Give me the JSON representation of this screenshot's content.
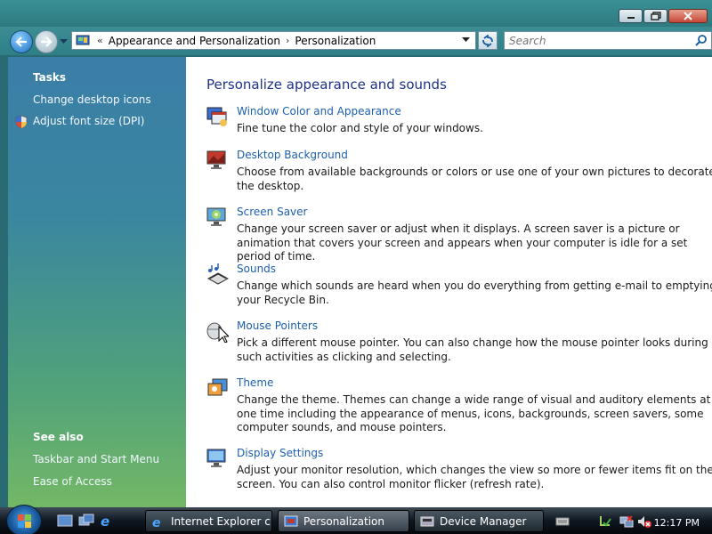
{
  "address": {
    "crumbs": [
      "Appearance and Personalization",
      "Personalization"
    ],
    "separator": "›"
  },
  "search": {
    "placeholder": "Search"
  },
  "sidebar": {
    "tasks_heading": "Tasks",
    "tasks": [
      "Change desktop icons",
      "Adjust font size (DPI)"
    ],
    "see_also_heading": "See also",
    "see_also": [
      "Taskbar and Start Menu",
      "Ease of Access"
    ]
  },
  "main": {
    "title": "Personalize appearance and sounds",
    "items": [
      {
        "label": "Window Color and Appearance",
        "desc": "Fine tune the color and style of your windows.",
        "icon": "window-color-icon"
      },
      {
        "label": "Desktop Background",
        "desc": "Choose from available backgrounds or colors or use one of your own pictures to decorate the desktop.",
        "icon": "desktop-background-icon"
      },
      {
        "label": "Screen Saver",
        "desc": "Change your screen saver or adjust when it displays. A screen saver is a picture or animation that covers your screen and appears when your computer is idle for a set period of time.",
        "icon": "screen-saver-icon"
      },
      {
        "label": "Sounds",
        "desc": "Change which sounds are heard when you do everything from getting e-mail to emptying your Recycle Bin.",
        "icon": "sounds-icon"
      },
      {
        "label": "Mouse Pointers",
        "desc": "Pick a different mouse pointer. You can also change how the mouse pointer looks during such activities as clicking and selecting.",
        "icon": "mouse-pointer-icon"
      },
      {
        "label": "Theme",
        "desc": "Change the theme. Themes can change a wide range of visual and auditory elements at one time including the appearance of menus, icons, backgrounds, screen savers, some computer sounds, and mouse pointers.",
        "icon": "theme-icon"
      },
      {
        "label": "Display Settings",
        "desc": "Adjust your monitor resolution, which changes the view so more or fewer items fit on the screen. You can also control monitor flicker (refresh rate).",
        "icon": "display-settings-icon"
      }
    ]
  },
  "taskbar": {
    "buttons": [
      "Internet Explorer c...",
      "Personalization",
      "Device Manager"
    ],
    "clock": "12:17 PM"
  }
}
